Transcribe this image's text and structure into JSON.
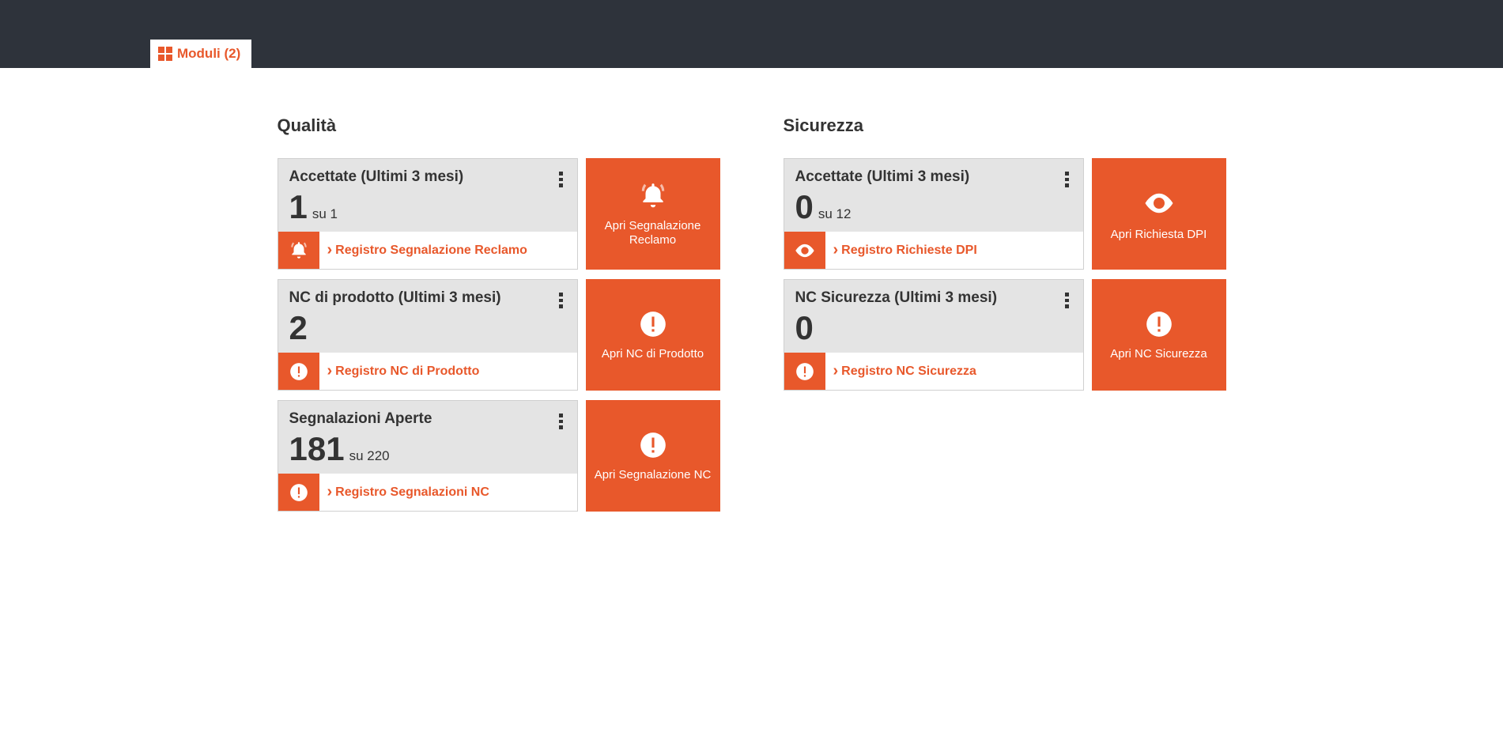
{
  "tab_label": "Moduli (2)",
  "columns": {
    "qualita": {
      "title": "Qualità",
      "cards": [
        {
          "title": "Accettate (Ultimi 3 mesi)",
          "value": "1",
          "suffix": "su 1",
          "linkLabel": "Registro Segnalazione Reclamo",
          "tileLabel": "Apri Segnalazione Reclamo",
          "icon": "bell"
        },
        {
          "title": "NC di prodotto (Ultimi 3 mesi)",
          "value": "2",
          "suffix": "",
          "linkLabel": "Registro NC di Prodotto",
          "tileLabel": "Apri NC di Prodotto",
          "icon": "alert"
        },
        {
          "title": "Segnalazioni Aperte",
          "value": "181",
          "suffix": "su 220",
          "linkLabel": "Registro Segnalazioni NC",
          "tileLabel": "Apri Segnalazione NC",
          "icon": "alert"
        }
      ]
    },
    "sicurezza": {
      "title": "Sicurezza",
      "cards": [
        {
          "title": "Accettate (Ultimi 3 mesi)",
          "value": "0",
          "suffix": "su 12",
          "linkLabel": "Registro Richieste DPI",
          "tileLabel": "Apri Richiesta DPI",
          "icon": "eye"
        },
        {
          "title": "NC Sicurezza (Ultimi 3 mesi)",
          "value": "0",
          "suffix": "",
          "linkLabel": "Registro NC Sicurezza",
          "tileLabel": "Apri NC Sicurezza",
          "icon": "alert"
        }
      ]
    }
  }
}
